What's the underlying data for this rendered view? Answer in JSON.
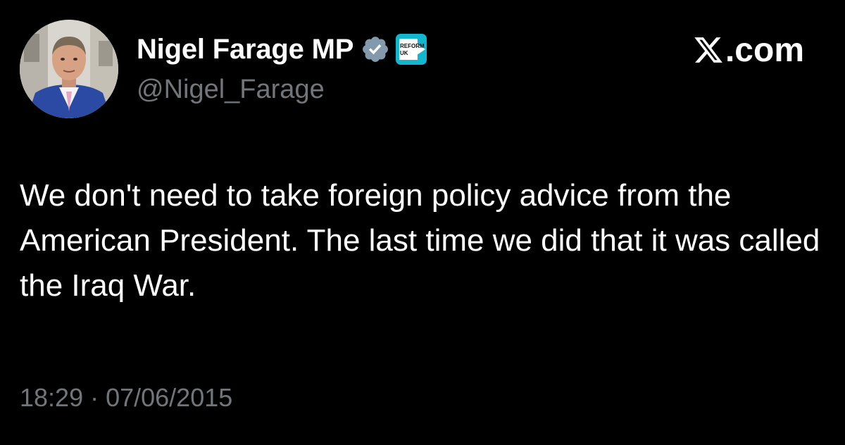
{
  "author": {
    "display_name": "Nigel Farage MP",
    "handle": "@Nigel_Farage",
    "verified": true,
    "verified_color": "#829aab",
    "affiliation_badge": {
      "label_top": "REFORM",
      "label_bottom": "UK",
      "color": "#12b6cf"
    },
    "avatar_icon": "profile-photo"
  },
  "brand": {
    "icon": "x-logo-icon",
    "suffix": ".com"
  },
  "tweet": {
    "text": "We don't need to take foreign policy advice from the American President. The last time we did that it was called the Iraq War."
  },
  "meta": {
    "timestamp": "18:29 · 07/06/2015"
  },
  "colors": {
    "background": "#000000",
    "primary_text": "#ffffff",
    "secondary_text": "#71767b"
  }
}
